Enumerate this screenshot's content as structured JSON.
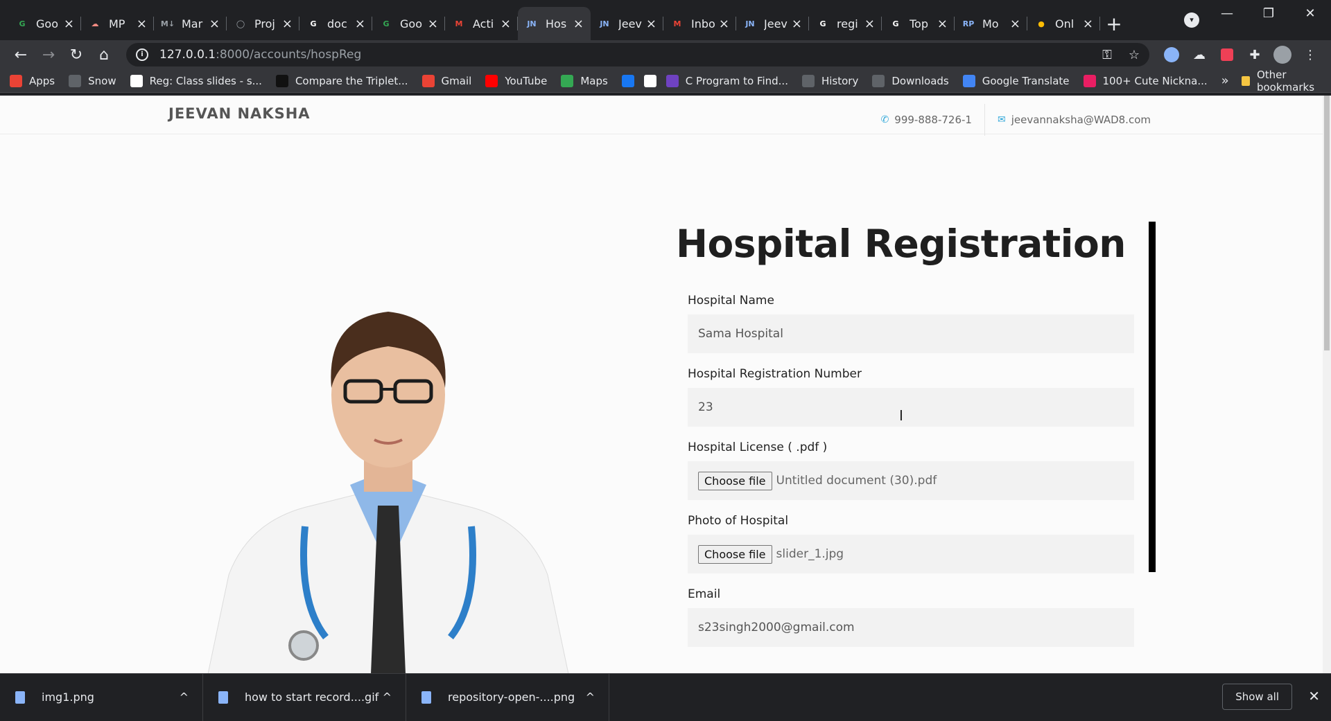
{
  "browser": {
    "tabs": [
      {
        "label": "Goo",
        "fav": "G",
        "color": "#34a853"
      },
      {
        "label": "MP",
        "fav": "☁",
        "color": "#f28b82"
      },
      {
        "label": "Mar",
        "fav": "M↓",
        "color": "#9aa0a6"
      },
      {
        "label": "Proj",
        "fav": "◯",
        "color": "#9aa0a6"
      },
      {
        "label": "doc",
        "fav": "G",
        "color": "#ffffff"
      },
      {
        "label": "Goo",
        "fav": "G",
        "color": "#34a853"
      },
      {
        "label": "Acti",
        "fav": "M",
        "color": "#ea4335"
      },
      {
        "label": "Hos",
        "fav": "JN",
        "color": "#8ab4f8"
      },
      {
        "label": "Jeev",
        "fav": "JN",
        "color": "#8ab4f8"
      },
      {
        "label": "Inbo",
        "fav": "M",
        "color": "#ea4335"
      },
      {
        "label": "Jeev",
        "fav": "JN",
        "color": "#8ab4f8"
      },
      {
        "label": "regi",
        "fav": "G",
        "color": "#ffffff"
      },
      {
        "label": "Top",
        "fav": "G",
        "color": "#ffffff"
      },
      {
        "label": "Mo",
        "fav": "RP",
        "color": "#8ab4f8"
      },
      {
        "label": "Onl",
        "fav": "●",
        "color": "#fbbc04"
      }
    ],
    "active_tab_index": 7,
    "new_tab_label": "+",
    "url_host": "127.0.0.1",
    "url_path": ":8000/accounts/hospReg",
    "bookmarks": [
      {
        "label": "Apps",
        "icon": "apps-icon",
        "color": "#ea4335"
      },
      {
        "label": "Snow",
        "icon": "globe-icon",
        "color": "#5f6368"
      },
      {
        "label": "Reg: Class slides - s...",
        "icon": "google-icon",
        "color": "#ffffff"
      },
      {
        "label": "Compare the Triplet...",
        "icon": "hackerrank-icon",
        "color": "#111111"
      },
      {
        "label": "Gmail",
        "icon": "gmail-icon",
        "color": "#ea4335"
      },
      {
        "label": "YouTube",
        "icon": "youtube-icon",
        "color": "#ff0000"
      },
      {
        "label": "Maps",
        "icon": "maps-icon",
        "color": "#34a853"
      },
      {
        "label": "",
        "icon": "facebook-icon",
        "color": "#1877f2"
      },
      {
        "label": "",
        "icon": "google-icon",
        "color": "#ffffff"
      },
      {
        "label": "C Program to Find...",
        "icon": "programiz-icon",
        "color": "#6f42c1"
      },
      {
        "label": "History",
        "icon": "history-icon",
        "color": "#5f6368"
      },
      {
        "label": "Downloads",
        "icon": "download-icon",
        "color": "#5f6368"
      },
      {
        "label": "Google Translate",
        "icon": "translate-icon",
        "color": "#4285f4"
      },
      {
        "label": "100+ Cute Nickna...",
        "icon": "heart-icon",
        "color": "#e91e63"
      }
    ],
    "bookmarks_more": "»",
    "other_bookmarks": "Other bookmarks"
  },
  "site": {
    "brand": "JEEVAN NAKSHA",
    "phone": "999-888-726-1",
    "email": "jeevannaksha@WAD8.com"
  },
  "form": {
    "title": "Hospital Registration",
    "hospital_name_label": "Hospital Name",
    "hospital_name_value": "Sama  Hospital",
    "reg_number_label": "Hospital Registration Number",
    "reg_number_value": "23",
    "license_label": "Hospital License ( .pdf )",
    "license_button": "Choose file",
    "license_file": "Untitled document (30).pdf",
    "photo_label": "Photo of Hospital",
    "photo_button": "Choose file",
    "photo_file": "slider_1.jpg",
    "email_label": "Email",
    "email_value": "s23singh2000@gmail.com"
  },
  "downloads": {
    "items": [
      "img1.png",
      "how to start record....gif",
      "repository-open-....png"
    ],
    "show_all": "Show all"
  }
}
